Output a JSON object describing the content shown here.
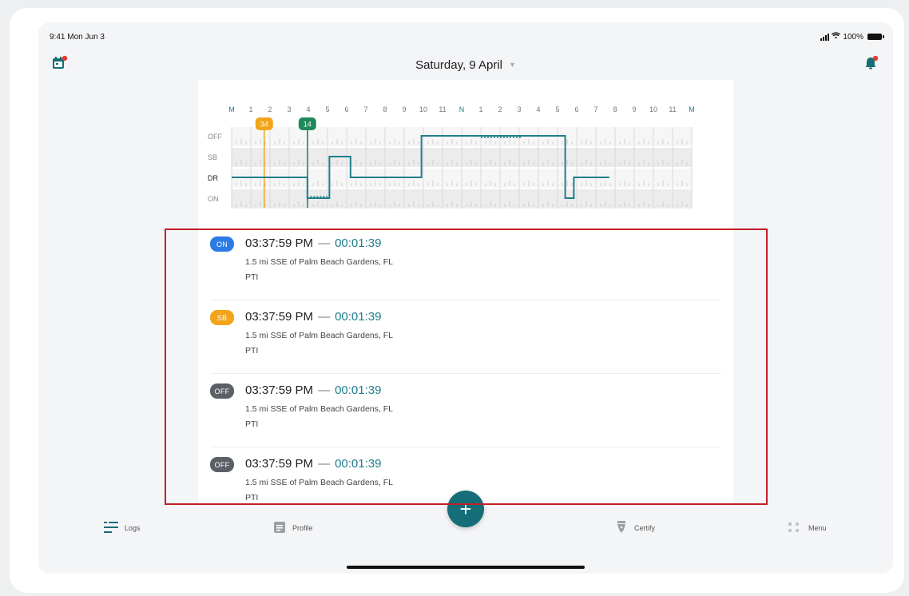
{
  "status_bar": {
    "time": "9:41 Mon Jun 3",
    "battery": "100%"
  },
  "header": {
    "date": "Saturday, 9 April"
  },
  "chart": {
    "hour_labels": [
      "M",
      "1",
      "2",
      "3",
      "4",
      "5",
      "6",
      "7",
      "8",
      "9",
      "10",
      "11",
      "N",
      "1",
      "2",
      "3",
      "4",
      "5",
      "6",
      "7",
      "8",
      "9",
      "10",
      "11",
      "M"
    ],
    "rows": [
      "OFF",
      "SB",
      "DR",
      "ON"
    ],
    "markers": [
      {
        "label": "34",
        "color": "#f2a51a"
      },
      {
        "label": "14",
        "color": "#1e8a5c"
      }
    ],
    "line_color": "#1e7e8c"
  },
  "events": [
    {
      "status": "ON",
      "status_class": "on",
      "time": "03:37:59 PM",
      "dash": "—",
      "duration": "00:01:39",
      "location": "1.5 mi SSE of Palm Beach Gardens, FL",
      "note": "PTI"
    },
    {
      "status": "SB",
      "status_class": "sb",
      "time": "03:37:59 PM",
      "dash": "—",
      "duration": "00:01:39",
      "location": "1.5 mi SSE of Palm Beach Gardens, FL",
      "note": "PTI"
    },
    {
      "status": "OFF",
      "status_class": "off",
      "time": "03:37:59 PM",
      "dash": "—",
      "duration": "00:01:39",
      "location": "1.5 mi SSE of Palm Beach Gardens, FL",
      "note": "PTI"
    },
    {
      "status": "OFF",
      "status_class": "off",
      "time": "03:37:59 PM",
      "dash": "—",
      "duration": "00:01:39",
      "location": "1.5 mi SSE of Palm Beach Gardens, FL",
      "note": "PTI"
    }
  ],
  "tabs": {
    "logs": "Logs",
    "profile": "Profile",
    "certify": "Certify",
    "menu": "Menu"
  },
  "fab": {
    "label": "+"
  },
  "colors": {
    "accent": "#156d77",
    "on": "#2c7be5",
    "sb": "#f2a51a",
    "off": "#5c6066",
    "notification": "#e53935"
  }
}
